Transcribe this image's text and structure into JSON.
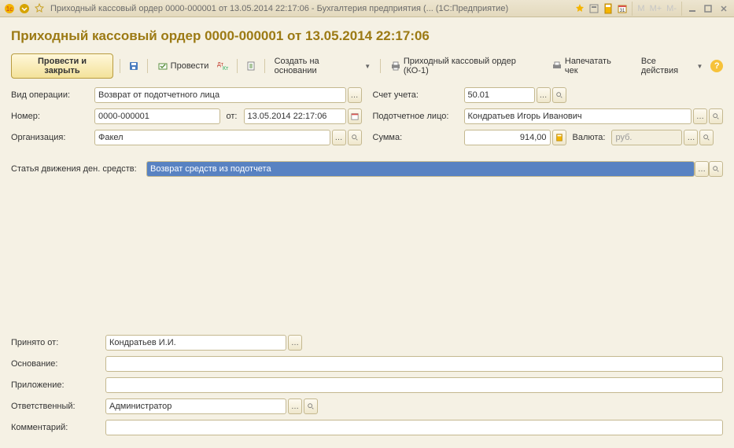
{
  "window": {
    "title": "Приходный кассовый ордер 0000-000001 от 13.05.2014 22:17:06 - Бухгалтерия предприятия (...  (1С:Предприятие)"
  },
  "page": {
    "title": "Приходный кассовый ордер 0000-000001 от 13.05.2014 22:17:06"
  },
  "toolbar": {
    "post_and_close": "Провести и закрыть",
    "post": "Провести",
    "create_based_on": "Создать на основании",
    "print_ko1": "Приходный кассовый ордер (КО-1)",
    "print_check": "Напечатать чек",
    "all_actions": "Все действия"
  },
  "labels": {
    "operation_type": "Вид операции:",
    "number": "Номер:",
    "from": "от:",
    "organization": "Организация:",
    "account": "Счет учета:",
    "accountable_person": "Подотчетное лицо:",
    "amount": "Сумма:",
    "currency": "Валюта:",
    "cash_flow_item": "Статья движения ден. средств:",
    "received_from": "Принято от:",
    "basis": "Основание:",
    "attachment": "Приложение:",
    "responsible": "Ответственный:",
    "comment": "Комментарий:"
  },
  "fields": {
    "operation_type": "Возврат от подотчетного лица",
    "number": "0000-000001",
    "date": "13.05.2014 22:17:06",
    "organization": "Факел",
    "account": "50.01",
    "accountable_person": "Кондратьев Игорь Иванович",
    "amount": "914,00",
    "currency": "руб.",
    "cash_flow_item": "Возврат средств из подотчета",
    "received_from": "Кондратьев И.И.",
    "basis": "",
    "attachment": "",
    "responsible": "Администратор",
    "comment": ""
  }
}
